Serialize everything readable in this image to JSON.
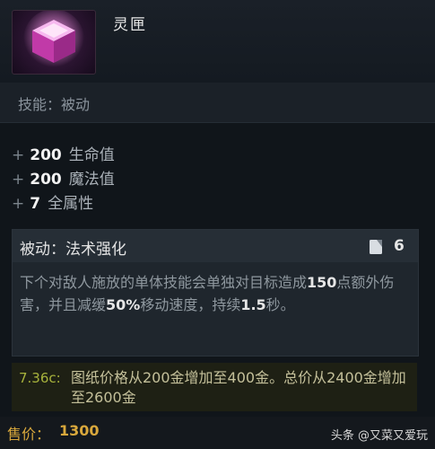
{
  "item": {
    "name": "灵匣",
    "icon": "pink-cube-icon"
  },
  "ability_line": "技能：被动",
  "stats": [
    {
      "plus": "+",
      "value": "200",
      "label": "生命值"
    },
    {
      "plus": "+",
      "value": "200",
      "label": "魔法值"
    },
    {
      "plus": "+",
      "value": "7",
      "label": "全属性"
    }
  ],
  "passive": {
    "title": "被动：法术强化",
    "cooldown_icon": "cooldown-icon",
    "cooldown": "6",
    "desc": {
      "part1": "下个对敌人施放的单体技能会单独对目标造成",
      "dmg": "150",
      "part2": "点额外伤害，并且减缓",
      "slow": "50%",
      "part3": "移动速度，持续",
      "dur": "1.5",
      "part4": "秒。"
    }
  },
  "patch": {
    "tag": "7.36c:",
    "text": "图纸价格从200金增加至400金。总价从2400金增加至2600金"
  },
  "price": {
    "label": "售价：",
    "value": "1300"
  },
  "watermark": "头条 @又菜又爱玩",
  "colors": {
    "gold": "#d9a83c",
    "patch_green": "#a7b23c",
    "background": "#10151a"
  }
}
